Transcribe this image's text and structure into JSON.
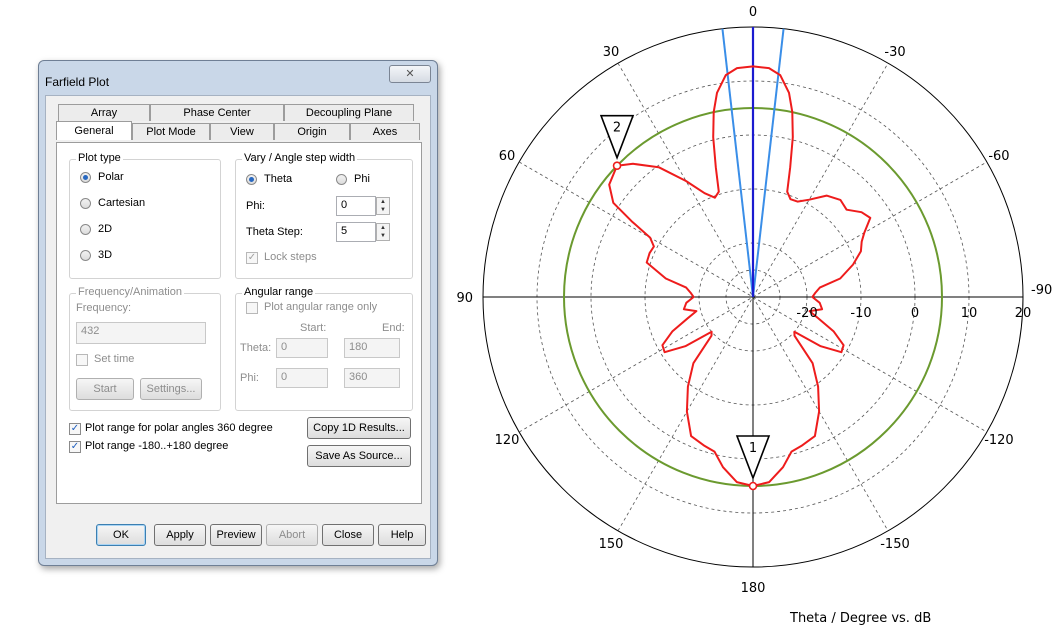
{
  "dialog": {
    "title": "Farfield Plot",
    "close_glyph": "✕",
    "tabs_back": [
      "Array",
      "Phase Center",
      "Decoupling Plane"
    ],
    "tabs_front": [
      "General",
      "Plot Mode",
      "View",
      "Origin",
      "Axes"
    ],
    "plot_type": {
      "title": "Plot type",
      "options": [
        "Polar",
        "Cartesian",
        "2D",
        "3D"
      ],
      "selected": "Polar"
    },
    "vary": {
      "title": "Vary / Angle step width",
      "theta_label": "Theta",
      "phi_label": "Phi",
      "phi_field_label": "Phi:",
      "phi_value": "0",
      "theta_step_label": "Theta Step:",
      "theta_step_value": "5",
      "lock_steps": "Lock steps"
    },
    "frequency": {
      "title": "Frequency/Animation",
      "frequency_label": "Frequency:",
      "frequency_value": "432",
      "set_time": "Set time",
      "start": "Start",
      "settings": "Settings..."
    },
    "angular": {
      "title": "Angular range",
      "only_label": "Plot angular range only",
      "start_label": "Start:",
      "end_label": "End:",
      "theta_label": "Theta:",
      "theta_start": "0",
      "theta_end": "180",
      "phi_label": "Phi:",
      "phi_start": "0",
      "phi_end": "360"
    },
    "polar_360": "Plot range for polar angles 360 degree",
    "range_180": "Plot range -180..+180 degree",
    "copy_1d": "Copy 1D Results...",
    "save_source": "Save As Source...",
    "buttons": {
      "ok": "OK",
      "apply": "Apply",
      "preview": "Preview",
      "abort": "Abort",
      "close": "Close",
      "help": "Help"
    }
  },
  "chart_data": {
    "type": "polar",
    "xlabel": "Theta / Degree vs. dB",
    "angle_labels": [
      {
        "angle": 0,
        "text": "0"
      },
      {
        "angle": 30,
        "text": "30"
      },
      {
        "angle": 60,
        "text": "60"
      },
      {
        "angle": 90,
        "text": "90"
      },
      {
        "angle": 120,
        "text": "120"
      },
      {
        "angle": 150,
        "text": "150"
      },
      {
        "angle": 180,
        "text": "180"
      },
      {
        "angle": -150,
        "text": "-150"
      },
      {
        "angle": -120,
        "text": "-120"
      },
      {
        "angle": -90,
        "text": "-90"
      },
      {
        "angle": -60,
        "text": "-60"
      },
      {
        "angle": -30,
        "text": "-30"
      }
    ],
    "radial_range": [
      -30,
      20
    ],
    "radial_ticks": [
      -20,
      -10,
      0,
      10,
      20
    ],
    "radial_tick_labels": [
      "-20",
      "-10",
      "0",
      "10",
      "20"
    ],
    "reference_level_db": 5,
    "main_lobe_dir": 0,
    "beamwidth_lines": [
      -6.5,
      6.5
    ],
    "markers": [
      {
        "label": "1",
        "angle": 180,
        "db": 5
      },
      {
        "label": "2",
        "angle": 46,
        "db": 5
      }
    ],
    "pattern": [
      [
        0,
        12.7
      ],
      [
        4,
        12.5
      ],
      [
        7,
        11.4
      ],
      [
        10,
        8.4
      ],
      [
        12,
        5
      ],
      [
        14,
        0.5
      ],
      [
        16,
        -5
      ],
      [
        18,
        -9.5
      ],
      [
        21,
        -10.3
      ],
      [
        25,
        -8.8
      ],
      [
        30,
        -5.2
      ],
      [
        36,
        -0.3
      ],
      [
        42,
        3.2
      ],
      [
        46,
        5
      ],
      [
        52,
        3.8
      ],
      [
        56,
        1.2
      ],
      [
        58,
        -3.5
      ],
      [
        60,
        -8
      ],
      [
        63,
        -9.4
      ],
      [
        67,
        -9.2
      ],
      [
        72,
        -9.3
      ],
      [
        78,
        -13.5
      ],
      [
        82,
        -17.5
      ],
      [
        86,
        -18.4
      ],
      [
        90,
        -19
      ],
      [
        95,
        -17.6
      ],
      [
        100,
        -17
      ],
      [
        104,
        -19.2
      ],
      [
        108,
        -17.3
      ],
      [
        113,
        -13.8
      ],
      [
        118,
        -11
      ],
      [
        122,
        -10.7
      ],
      [
        126,
        -14.5
      ],
      [
        130,
        -20
      ],
      [
        133,
        -19.5
      ],
      [
        138,
        -13.5
      ],
      [
        144,
        -9.5
      ],
      [
        150,
        -5.5
      ],
      [
        156,
        -1.8
      ],
      [
        162,
        -1
      ],
      [
        166,
        -0.5
      ],
      [
        170,
        2
      ],
      [
        175,
        4.4
      ],
      [
        180,
        5
      ],
      [
        -175,
        4.4
      ],
      [
        -170,
        2
      ],
      [
        -166,
        -0.5
      ],
      [
        -162,
        -1
      ],
      [
        -156,
        -1.8
      ],
      [
        -150,
        -5.5
      ],
      [
        -144,
        -9.5
      ],
      [
        -138,
        -13.5
      ],
      [
        -133,
        -19.5
      ],
      [
        -130,
        -20
      ],
      [
        -126,
        -14.5
      ],
      [
        -122,
        -10.7
      ],
      [
        -118,
        -11
      ],
      [
        -113,
        -13.8
      ],
      [
        -108,
        -17.3
      ],
      [
        -104,
        -19.2
      ],
      [
        -100,
        -17
      ],
      [
        -95,
        -17.6
      ],
      [
        -90,
        -19
      ],
      [
        -86,
        -18.4
      ],
      [
        -82,
        -17.5
      ],
      [
        -78,
        -13.5
      ],
      [
        -72,
        -10.5
      ],
      [
        -67,
        -8.3
      ],
      [
        -63,
        -7.4
      ],
      [
        -60,
        -6.2
      ],
      [
        -56,
        -3.8
      ],
      [
        -52,
        -4.5
      ],
      [
        -47,
        -6.3
      ],
      [
        -42,
        -5.8
      ],
      [
        -36,
        -6.8
      ],
      [
        -30,
        -9.2
      ],
      [
        -25,
        -10.5
      ],
      [
        -21,
        -10.6
      ],
      [
        -18,
        -9.5
      ],
      [
        -16,
        -5
      ],
      [
        -14,
        0.5
      ],
      [
        -12,
        5
      ],
      [
        -10,
        8.4
      ],
      [
        -7,
        11.4
      ],
      [
        -4,
        12.5
      ],
      [
        0,
        12.7
      ]
    ],
    "colors": {
      "pattern": "#ee1c1c",
      "reference": "#6b9a2f",
      "main_lobe": "#1b1bd0",
      "beamwidth": "#3a8ee8",
      "grid": "#555555",
      "axis": "#000000"
    }
  }
}
